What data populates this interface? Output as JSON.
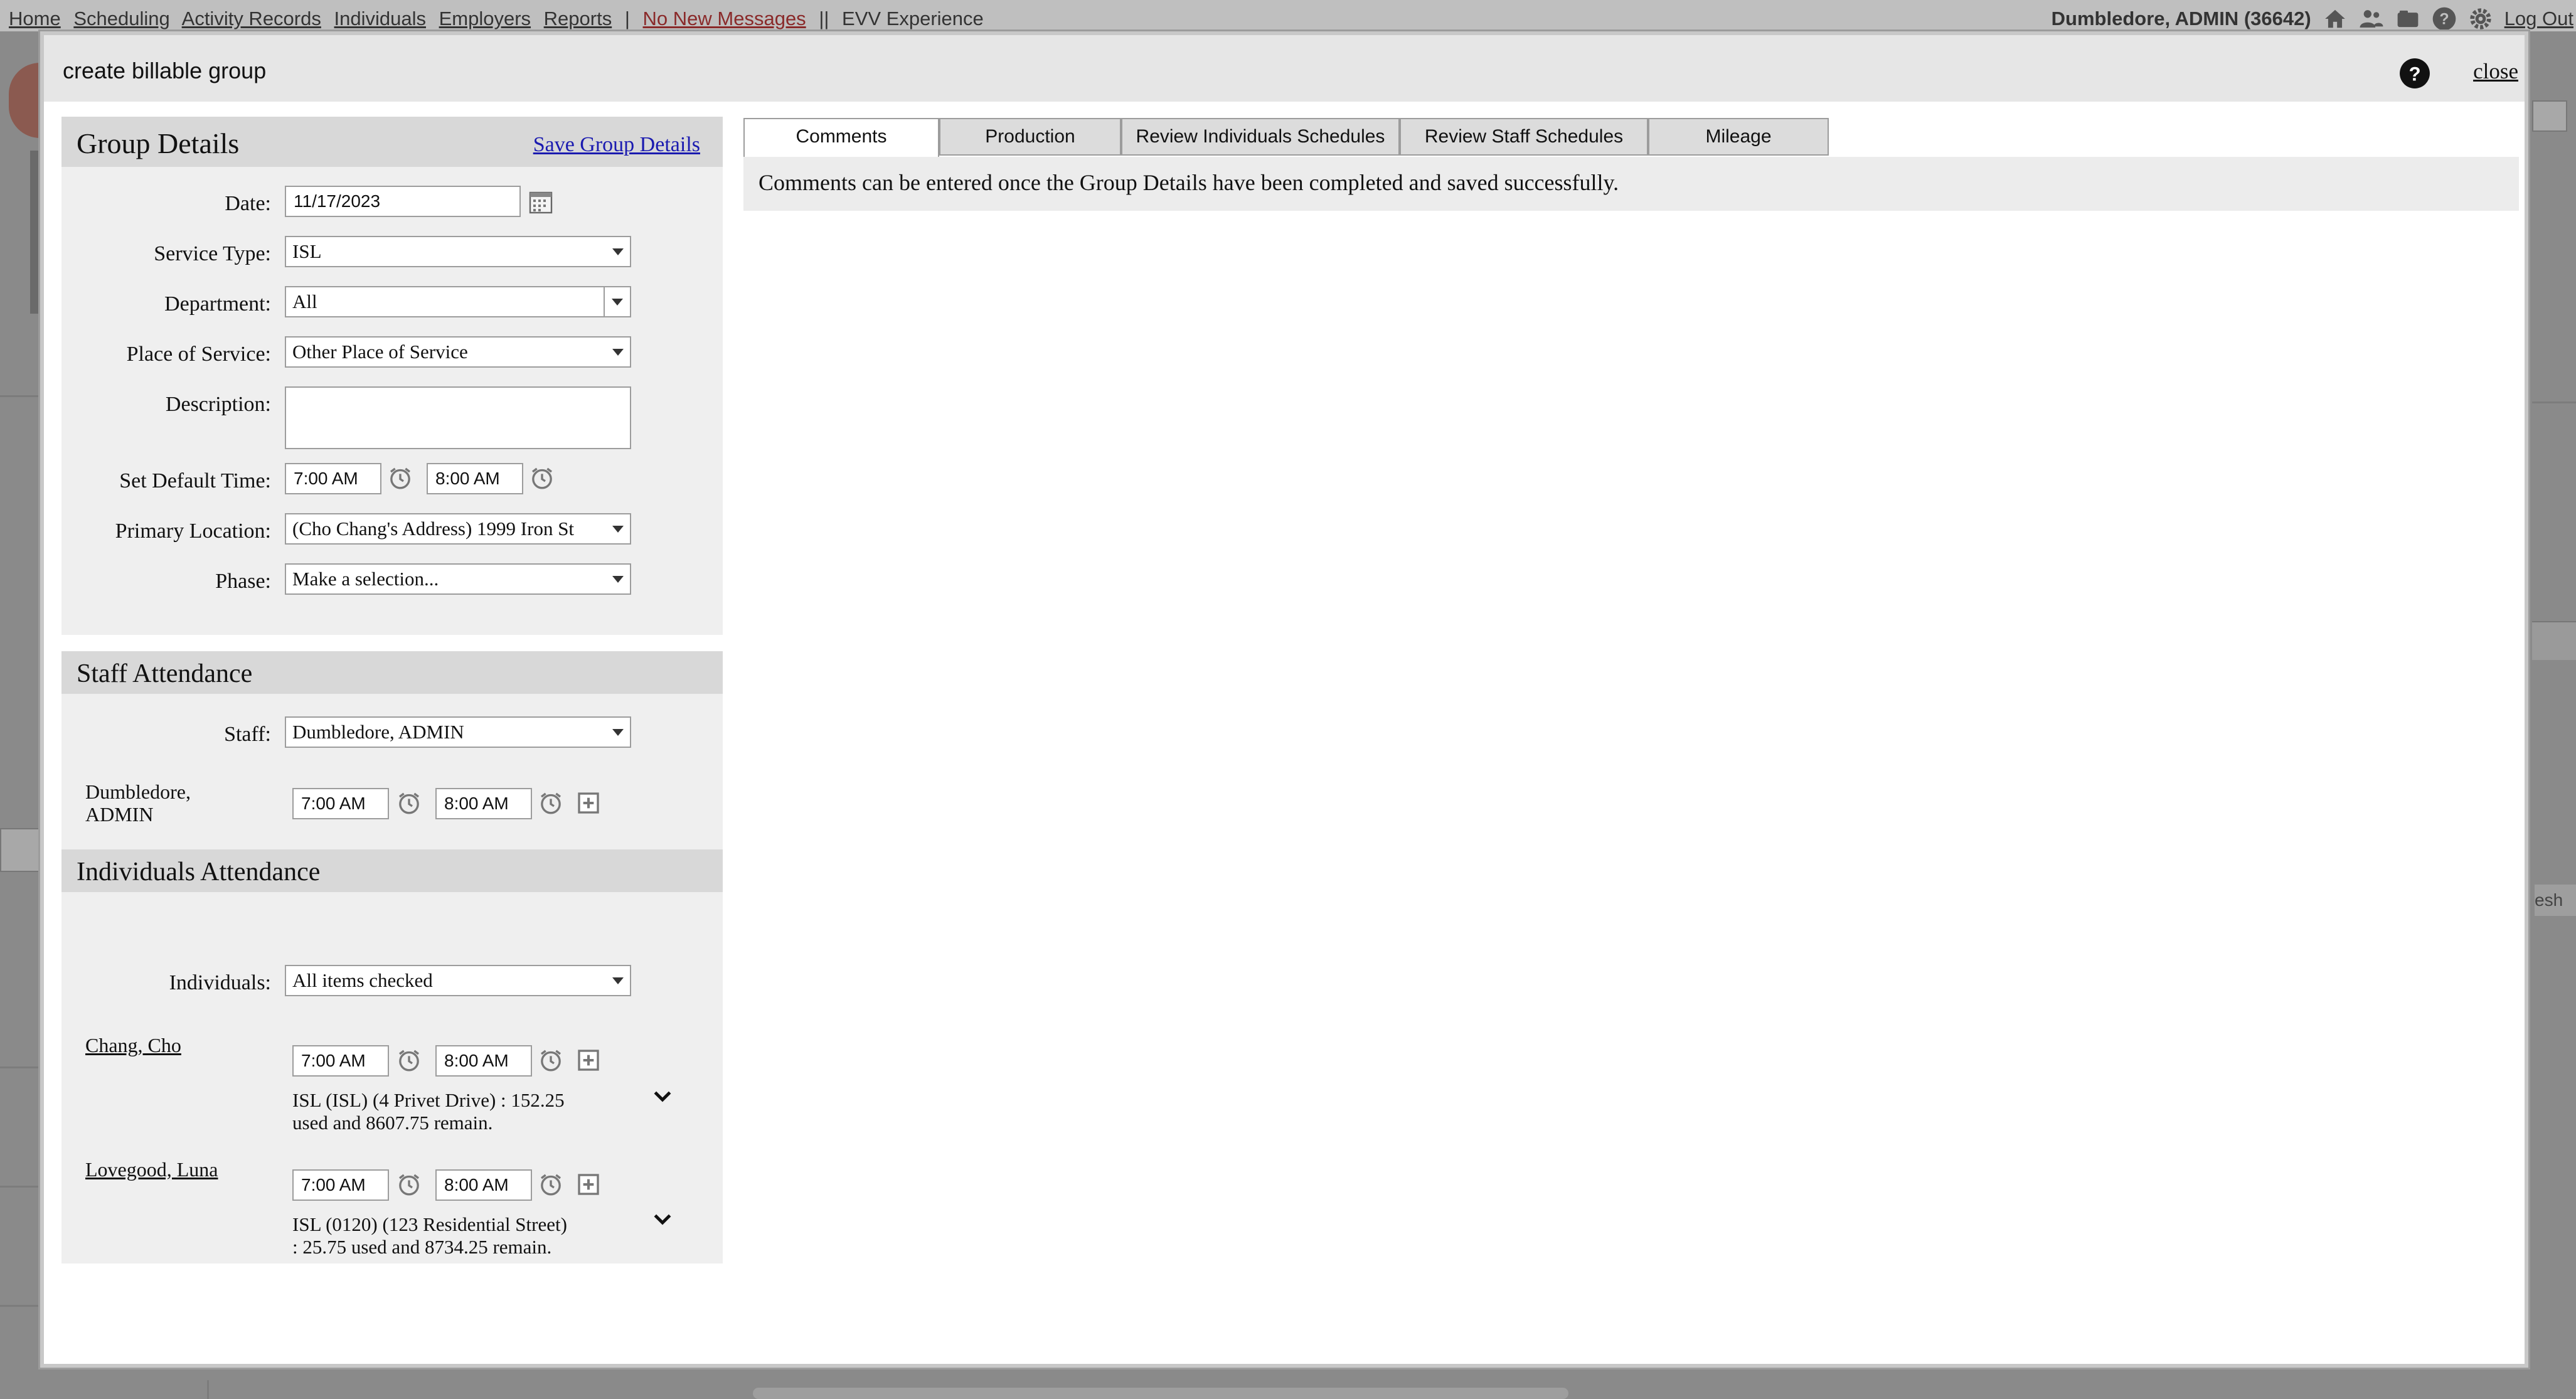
{
  "topnav": {
    "items": [
      "Home",
      "Scheduling",
      "Activity Records",
      "Individuals",
      "Employers",
      "Reports"
    ],
    "separator": "|",
    "messages": "No New Messages",
    "separator2": "||",
    "evv": "EVV Experience",
    "user": "Dumbledore, ADMIN",
    "user_id": "(36642)",
    "icons": [
      "home-icon",
      "users-icon",
      "folder-icon",
      "help-icon",
      "gear-icon"
    ],
    "logout": "Log Out"
  },
  "modal": {
    "title": "create billable group",
    "close": "close"
  },
  "group_details": {
    "heading": "Group Details",
    "save_link": "Save Group Details",
    "date_label": "Date:",
    "date_value": "11/17/2023",
    "service_type_label": "Service Type:",
    "service_type_value": "ISL",
    "department_label": "Department:",
    "department_value": "All",
    "place_label": "Place of Service:",
    "place_value": "Other Place of Service",
    "description_label": "Description:",
    "description_value": "",
    "default_time_label": "Set Default Time:",
    "default_start": "7:00 AM",
    "default_end": "8:00 AM",
    "primary_location_label": "Primary Location:",
    "primary_location_value": "(Cho Chang's Address) 1999 Iron St",
    "phase_label": "Phase:",
    "phase_value": "Make a selection..."
  },
  "staff_attendance": {
    "heading": "Staff Attendance",
    "staff_label": "Staff:",
    "staff_value": "Dumbledore, ADMIN",
    "rows": [
      {
        "name_line1": "Dumbledore,",
        "name_line2": "ADMIN",
        "start": "7:00 AM",
        "end": "8:00 AM"
      }
    ]
  },
  "individuals_attendance": {
    "heading": "Individuals Attendance",
    "individuals_label": "Individuals:",
    "individuals_value": "All items checked",
    "rows": [
      {
        "name": "Chang, Cho",
        "start": "7:00 AM",
        "end": "8:00 AM",
        "auth_line1": "ISL (ISL) (4 Privet Drive) : 152.25",
        "auth_line2": "used and 8607.75 remain."
      },
      {
        "name": "Lovegood, Luna",
        "start": "7:00 AM",
        "end": "8:00 AM",
        "auth_line1": "ISL (0120) (123 Residential Street)",
        "auth_line2": ": 25.75 used and 8734.25 remain."
      }
    ]
  },
  "tabs": [
    {
      "label": "Comments",
      "active": true
    },
    {
      "label": "Production",
      "active": false
    },
    {
      "label": "Review Individuals Schedules",
      "active": false
    },
    {
      "label": "Review Staff Schedules",
      "active": false
    },
    {
      "label": "Mileage",
      "active": false
    }
  ],
  "comments_message": "Comments can be entered once the Group Details have been completed and saved successfully.",
  "background": {
    "partial_text": "esh"
  }
}
